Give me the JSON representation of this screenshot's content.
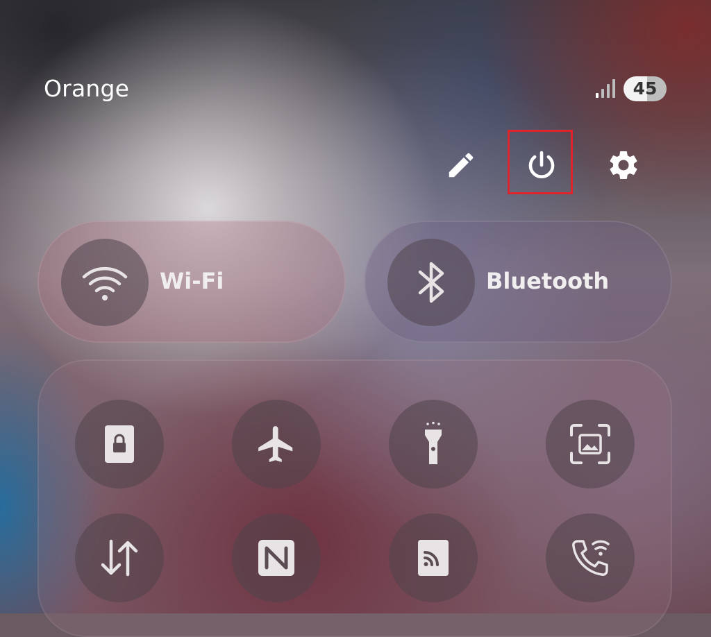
{
  "status_bar": {
    "carrier": "Orange",
    "signal_icon": "signal-bars-icon",
    "battery_level": "45"
  },
  "header_actions": [
    {
      "name": "edit",
      "icon": "pencil-icon"
    },
    {
      "name": "power",
      "icon": "power-icon",
      "highlighted": true
    },
    {
      "name": "settings",
      "icon": "gear-icon"
    }
  ],
  "tiles": {
    "wifi": {
      "label": "Wi-Fi",
      "icon": "wifi-icon"
    },
    "bluetooth": {
      "label": "Bluetooth",
      "icon": "bluetooth-icon"
    }
  },
  "quick_settings": [
    {
      "name": "lock-screen",
      "icon": "lock-screen-icon"
    },
    {
      "name": "airplane-mode",
      "icon": "airplane-icon"
    },
    {
      "name": "flashlight",
      "icon": "flashlight-icon"
    },
    {
      "name": "screenshot",
      "icon": "screenshot-icon"
    },
    {
      "name": "mobile-data",
      "icon": "data-transfer-icon"
    },
    {
      "name": "nfc",
      "icon": "nfc-icon"
    },
    {
      "name": "cast",
      "icon": "cast-icon"
    },
    {
      "name": "wifi-calling",
      "icon": "wifi-calling-icon"
    }
  ],
  "colors": {
    "highlight": "#e0242c",
    "tile_icon": "#e8e4e6"
  }
}
